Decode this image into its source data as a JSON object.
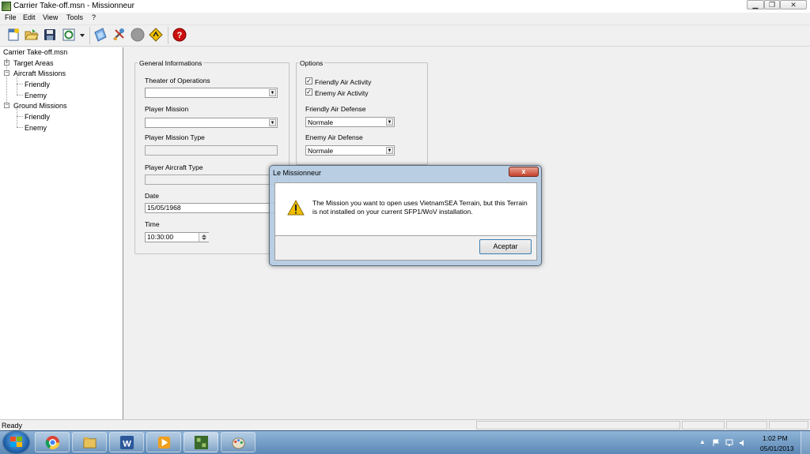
{
  "window": {
    "title": "Carrier Take-off.msn - Missionneur",
    "min_glyph": "▁",
    "max_glyph": "❐",
    "close_glyph": "✕"
  },
  "menu": [
    "File",
    "Edit",
    "View",
    "Tools",
    "?"
  ],
  "toolbar": {
    "icons": [
      "new-file-icon",
      "open-folder-icon",
      "save-icon",
      "refresh-icon",
      "dropdown-arrow-icon",
      "map-icon",
      "tools-icon",
      "gray-circle-icon",
      "warning-sign-icon",
      "help-icon"
    ]
  },
  "tree": {
    "root": "Carrier Take-off.msn",
    "target_areas": "Target Areas",
    "aircraft_missions": "Aircraft Missions",
    "ground_missions": "Ground Missions",
    "friendly": "Friendly",
    "enemy": "Enemy",
    "expand_glyph": "+",
    "collapse_glyph": "−"
  },
  "general": {
    "title": "General Informations",
    "theater_label": "Theater of Operations",
    "player_mission_label": "Player Mission",
    "player_mission_type_label": "Player Mission Type",
    "player_aircraft_type_label": "Player Aircraft Type",
    "date_label": "Date",
    "date_value": "15/05/1968",
    "time_label": "Time",
    "time_value": "10:30:00"
  },
  "options": {
    "title": "Options",
    "friendly_air_activity": "Friendly Air Activity",
    "enemy_air_activity": "Enemy Air Activity",
    "friendly_air_activity_checked": true,
    "enemy_air_activity_checked": true,
    "friendly_air_defense_label": "Friendly Air Defense",
    "friendly_air_defense_value": "Normale",
    "enemy_air_defense_label": "Enemy Air Defense",
    "enemy_air_defense_value": "Normale",
    "check_glyph": "✓"
  },
  "dialog": {
    "title": "Le Missionneur",
    "message": "The Mission you want to open uses VietnamSEA Terrain, but this Terrain is not installed on your current SFP1/WoV installation.",
    "ok_label": "Aceptar",
    "close_glyph": "x",
    "warning_glyph": "!"
  },
  "status": {
    "text": "Ready"
  },
  "taskbar": {
    "apps": [
      "chrome-icon",
      "file-explorer-icon",
      "word-icon",
      "media-player-icon",
      "missionneur-icon",
      "paint-icon"
    ],
    "time": "1:02 PM",
    "date": "05/01/2013",
    "tray_up_glyph": "▲"
  },
  "colors": {
    "chrome": "#db4437",
    "word": "#2b579a",
    "help": "#cc1010",
    "warning": "#f0c000"
  }
}
